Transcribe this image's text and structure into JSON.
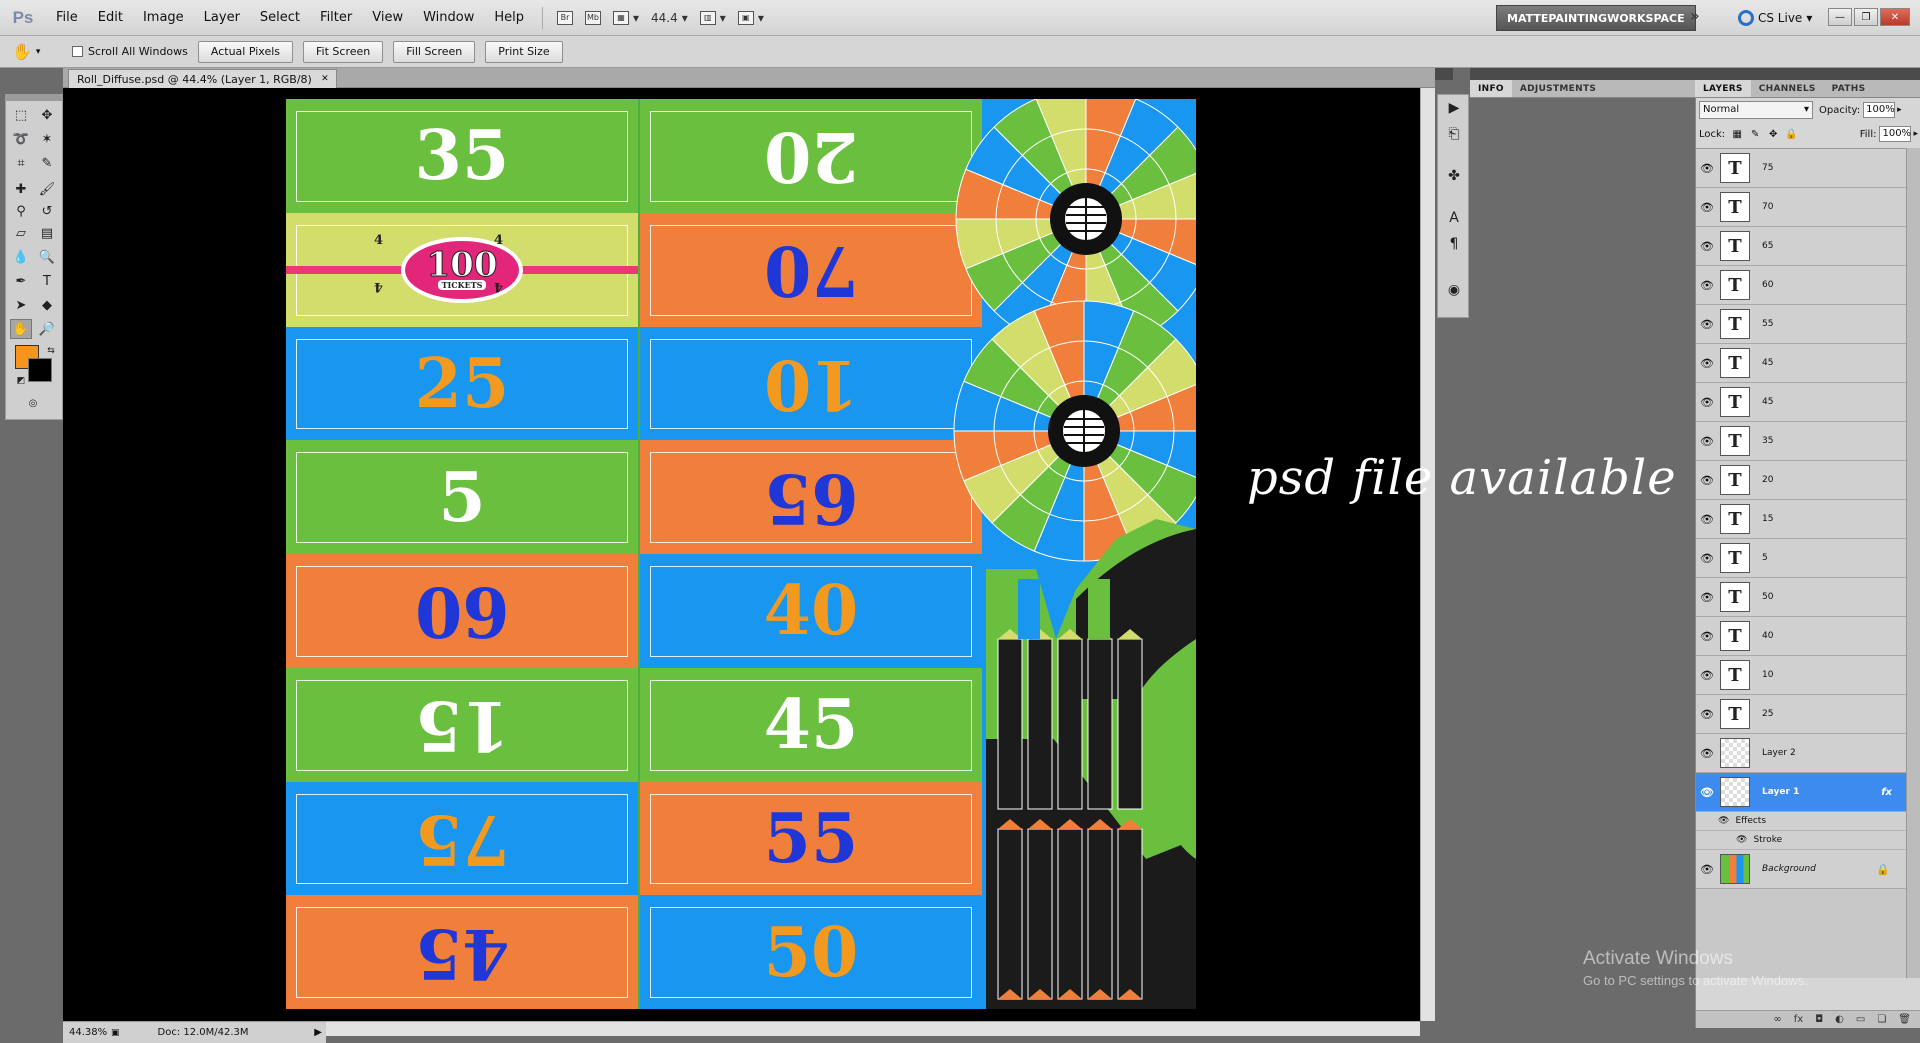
{
  "app": {
    "logo": "Ps"
  },
  "menu": [
    "File",
    "Edit",
    "Image",
    "Layer",
    "Select",
    "Filter",
    "View",
    "Window",
    "Help"
  ],
  "menubar_tools": {
    "zoom_value": "44.4",
    "br_label": "Br",
    "mb_label": "Mb"
  },
  "workspace": {
    "label": "MATTEPAINTINGWORKSPACE",
    "more": "»",
    "cs_live": "CS Live"
  },
  "options": {
    "scroll_all_windows": "Scroll All Windows",
    "actual_pixels": "Actual Pixels",
    "fit_screen": "Fit Screen",
    "fill_screen": "Fill Screen",
    "print_size": "Print Size"
  },
  "document": {
    "tab_title": "Roll_Diffuse.psd @ 44.4% (Layer 1, RGB/8)",
    "zoom": "44.38%",
    "doc_size": "Doc: 12.0M/42.3M"
  },
  "colors": {
    "foreground": "#f7941e",
    "background": "#000000",
    "selected_layer": "#3e8bf0"
  },
  "artwork": {
    "left_tickets": [
      {
        "value": "35",
        "flipped": false,
        "bg": "green",
        "text": "white"
      },
      {
        "value": "jackpot",
        "flipped": false,
        "bg": "yellow",
        "text": "white"
      },
      {
        "value": "25",
        "flipped": false,
        "bg": "blue",
        "text": "orange"
      },
      {
        "value": "5",
        "flipped": false,
        "bg": "green",
        "text": "white"
      },
      {
        "value": "60",
        "flipped": true,
        "bg": "orange",
        "text": "blue"
      },
      {
        "value": "15",
        "flipped": true,
        "bg": "green",
        "text": "white"
      },
      {
        "value": "75",
        "flipped": true,
        "bg": "blue",
        "text": "orange"
      },
      {
        "value": "45",
        "flipped": true,
        "bg": "orange",
        "text": "blue"
      }
    ],
    "right_tickets": [
      {
        "value": "20",
        "flipped": true,
        "bg": "green",
        "text": "white"
      },
      {
        "value": "70",
        "flipped": true,
        "bg": "orange",
        "text": "blue"
      },
      {
        "value": "10",
        "flipped": true,
        "bg": "blue",
        "text": "orange"
      },
      {
        "value": "65",
        "flipped": true,
        "bg": "orange",
        "text": "blue"
      },
      {
        "value": "40",
        "flipped": false,
        "bg": "blue",
        "text": "orange"
      },
      {
        "value": "45",
        "flipped": false,
        "bg": "green",
        "text": "white"
      },
      {
        "value": "55",
        "flipped": false,
        "bg": "orange",
        "text": "blue"
      },
      {
        "value": "50",
        "flipped": false,
        "bg": "blue",
        "text": "orange"
      }
    ],
    "jackpot": {
      "number": "100",
      "sub": "TICKETS",
      "corner": "4"
    }
  },
  "watermark": "psd file available",
  "info_tabs": [
    "INFO",
    "ADJUSTMENTS"
  ],
  "layer_tabs": [
    "LAYERS",
    "CHANNELS",
    "PATHS"
  ],
  "layers_panel": {
    "blend_mode": "Normal",
    "opacity_label": "Opacity:",
    "opacity": "100%",
    "lock_label": "Lock:",
    "fill_label": "Fill:",
    "fill": "100%"
  },
  "layers": [
    {
      "name": "75",
      "type": "text"
    },
    {
      "name": "70",
      "type": "text"
    },
    {
      "name": "65",
      "type": "text"
    },
    {
      "name": "60",
      "type": "text"
    },
    {
      "name": "55",
      "type": "text"
    },
    {
      "name": "45",
      "type": "text"
    },
    {
      "name": "45",
      "type": "text"
    },
    {
      "name": "35",
      "type": "text"
    },
    {
      "name": "20",
      "type": "text"
    },
    {
      "name": "15",
      "type": "text"
    },
    {
      "name": "5",
      "type": "text"
    },
    {
      "name": "50",
      "type": "text"
    },
    {
      "name": "40",
      "type": "text"
    },
    {
      "name": "10",
      "type": "text"
    },
    {
      "name": "25",
      "type": "text"
    },
    {
      "name": "Layer 2",
      "type": "raster"
    },
    {
      "name": "Layer 1",
      "type": "raster",
      "selected": true,
      "fx": "fx"
    },
    {
      "name": "Background",
      "type": "background"
    }
  ],
  "layer_effects": {
    "effects": "Effects",
    "stroke": "Stroke"
  },
  "text_layer_glyph": "T",
  "activate_windows": {
    "title": "Activate Windows",
    "subtitle": "Go to PC settings to activate Windows."
  }
}
